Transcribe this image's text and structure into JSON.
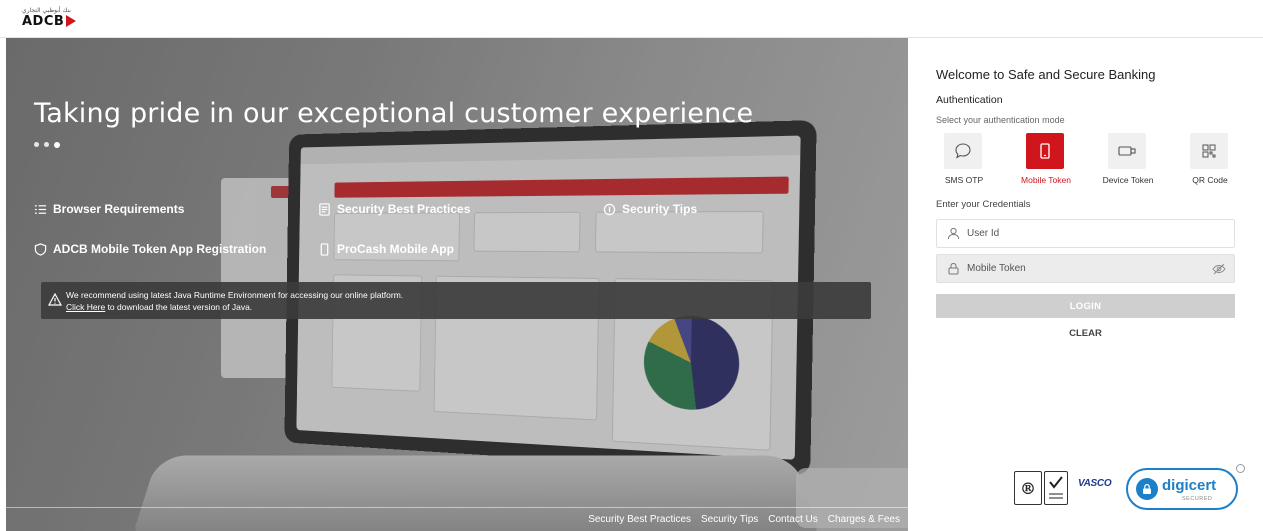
{
  "header": {
    "logo_text": "ADCB",
    "logo_arabic": "بنك أبوظبي التجاري"
  },
  "hero": {
    "title": "Taking pride in our exceptional customer experience",
    "carousel_dots": 3,
    "links": [
      {
        "label": "Browser Requirements",
        "icon": "list-icon"
      },
      {
        "label": "Security Best Practices",
        "icon": "document-icon"
      },
      {
        "label": "Security Tips",
        "icon": "shield-icon"
      },
      {
        "label": "ADCB Mobile Token App Registration",
        "icon": "shield-icon"
      },
      {
        "label": "ProCash Mobile App",
        "icon": "mobile-icon"
      }
    ],
    "java_banner": {
      "line1": "We recommend using latest Java Runtime Environment for accessing our online platform.",
      "link_text": "Click Here",
      "line2_rest": " to download the latest version of Java."
    },
    "footer_links": [
      "Security Best Practices",
      "Security Tips",
      "Contact Us",
      "Charges & Fees"
    ]
  },
  "login": {
    "welcome": "Welcome to Safe and Secure Banking",
    "auth_heading": "Authentication",
    "auth_sub": "Select your authentication mode",
    "modes": [
      {
        "label": "SMS OTP",
        "icon": "chat-bubble-icon",
        "active": false
      },
      {
        "label": "Mobile Token",
        "icon": "mobile-icon",
        "active": true
      },
      {
        "label": "Device Token",
        "icon": "device-token-icon",
        "active": false
      },
      {
        "label": "QR Code",
        "icon": "qr-code-icon",
        "active": false
      }
    ],
    "cred_heading": "Enter your Credentials",
    "user_id_placeholder": "User Id",
    "mobile_token_placeholder": "Mobile Token",
    "login_label": "LOGIN",
    "clear_label": "CLEAR"
  },
  "badges": {
    "vasco": "VASCO",
    "digicert": "digicert",
    "digicert_sub": "SECURED"
  },
  "colors": {
    "brand_red": "#d0161c",
    "digicert_blue": "#1c7fc9",
    "login_disabled": "#cfcfcf"
  }
}
